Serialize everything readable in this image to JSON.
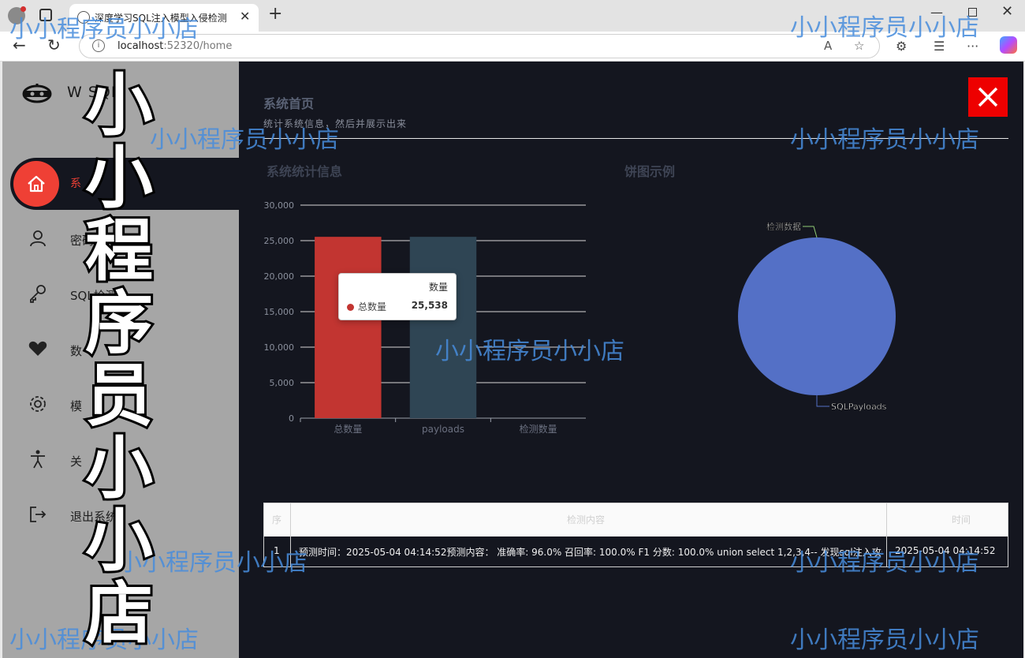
{
  "browser": {
    "tab_title": "深度学习SQL注入模型入侵检测",
    "url_host": "localhost",
    "url_rest": ":52320/home"
  },
  "app": {
    "brand": "W          SQL",
    "menu": [
      {
        "label": "系",
        "icon": "home-icon",
        "active": true
      },
      {
        "label": "密码",
        "icon": "user-icon"
      },
      {
        "label": "SQL检测",
        "icon": "key-icon"
      },
      {
        "label": "数",
        "icon": "heart-icon"
      },
      {
        "label": "模",
        "icon": "gear-icon"
      },
      {
        "label": "关",
        "icon": "accessibility-icon"
      },
      {
        "label": "退出系统",
        "icon": "logout-icon"
      }
    ]
  },
  "page": {
    "title": "系统首页",
    "subtitle": "统计系统信息，然后并展示出来",
    "bar_section": "系统统计信息",
    "pie_section": "饼图示例"
  },
  "chart_data": [
    {
      "type": "bar",
      "categories": [
        "总数量",
        "payloads",
        "检测数量"
      ],
      "series": [
        {
          "name": "总数量",
          "values": [
            25538,
            25538,
            0
          ]
        }
      ],
      "ylim": [
        0,
        30000
      ],
      "yticks": [
        "0",
        "5,000",
        "10,000",
        "15,000",
        "20,000",
        "25,000",
        "30,000"
      ],
      "colors": [
        "#c23531",
        "#2f4554",
        "#61a0a8"
      ],
      "grid": true,
      "tooltip": {
        "title": "数量",
        "name": "总数量",
        "value": "25,538"
      }
    },
    {
      "type": "pie",
      "labels": [
        "检测数据",
        "SQLPayloads"
      ],
      "values": [
        0,
        25538
      ],
      "colors": [
        "#91cc75",
        "#5470c6"
      ]
    }
  ],
  "table": {
    "headers": [
      "序",
      "检测内容",
      "时间"
    ],
    "rows": [
      {
        "index": "1",
        "content": "预测时间：2025-05-04 04:14:52预测内容： 准确率: 96.0% 召回率: 100.0% F1 分数: 100.0% union select 1,2,3,4-- 发现sql注入攻击",
        "time": "2025-05-04 04:14:52"
      }
    ]
  },
  "watermark": {
    "text": "小小程序员小小店",
    "vertical": "小小程序员小小店"
  }
}
